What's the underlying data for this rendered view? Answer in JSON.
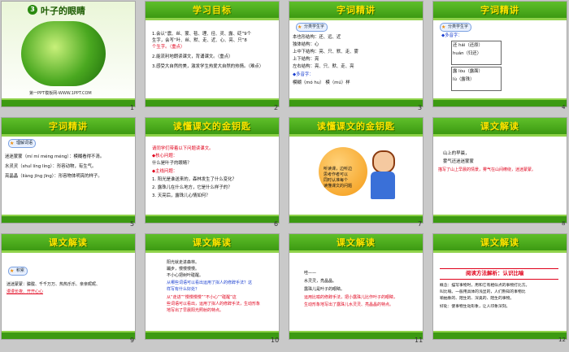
{
  "slides": [
    {
      "num": "1",
      "title": "叶子的眼睛",
      "badge_num": "3",
      "footer": "第一PPT模板网-WWW.1PPT.COM"
    },
    {
      "num": "2",
      "title": "学习目标",
      "lines": [
        "1.会认“震、丝、蒙、毯、理、径、灵、露、砭”9个",
        "  生字，会写“叶、丝、默、走、近、心、亮、只”8",
        "  个生字。（重点）",
        "2.能流利地朗读课文，背诵课文。（重点）",
        "3.感受大自然的美，激发学生热爱大自然的热情。（难点）"
      ]
    },
    {
      "num": "3",
      "title": "字词精讲",
      "badge": "分类学生字",
      "lines": [
        "  本也形结构：还、远、近",
        "  独体结构：心",
        "  上中下结构：亮、只、默、走、雾",
        "  上下结构：亮",
        "  左右结构：亮、只、默、走、亮",
        "  ◆多音字：",
        "  模糊（mó hu）    模（mú）样"
      ]
    },
    {
      "num": "4",
      "title": "字词精讲",
      "badge": "分类学生字",
      "lines": [
        "◆多音字：",
        "还  hái（还原）",
        "     huán（归还）",
        "露  lòu（露面）",
        "     lù（露珠）"
      ]
    },
    {
      "num": "5",
      "title": "字词精讲",
      "badge": "理解词语",
      "lines": [
        "迷迷蒙蒙（mí mí méng méng）：模糊看得不清。",
        "水灵灵（shuǐ líng líng）：形容动物，有生气。",
        "亮晶晶（liàng jīng jīng）：形容物体明亮的样子。"
      ]
    },
    {
      "num": "6",
      "title": "读懂课文的金钥匙",
      "lines": [
        "请同学们带着以下问题读课文。",
        "◆核心问题：",
        "  什么是叶子的眼睛？",
        "◆主线问题：",
        "  1. 阳光是谁送来的，森林发生了什么变化？",
        "  2. 露珠儿在什么地方，它是什么样子的？",
        "  3. 天亮后，露珠儿心情如何？"
      ]
    },
    {
      "num": "7",
      "title": "读懂课文的金钥匙",
      "bubble": [
        "听读课，边听边",
        "思考作者可以",
        "同时认准每个",
        "读懂课文的问题"
      ]
    },
    {
      "num": "8",
      "title": "课文解读",
      "lines": [
        "山上的早晨，",
        "雾气还迷迷蒙蒙",
        "描写了山上早晨的情景，雾气在山间缭绕，迷迷蒙蒙。"
      ]
    },
    {
      "num": "9",
      "title": "课文解读",
      "badge": "积累",
      "lines": [
        "迷迷蒙蒙：朦胧、千千万万、热热乐乐、亲亲昵昵、",
        "漫漫长夜、开开心心"
      ]
    },
    {
      "num": "10",
      "title": "课文解读",
      "lines": [
        "阳光就走进森林。",
        "  蹦步，慢慢慢慢。",
        "  不小心把树叶碰醒。",
        "从哪些词语可以看出运用了拟人的修辞手法？这",
        "样写有什么好处？",
        "从“走进”“慢慢慢慢”“不小心”“碰醒”这",
        "些词语可以看出，运用了拟人的修辞手法，生动形象",
        "地写出了早晨阳光照射的特点。"
      ]
    },
    {
      "num": "11",
      "title": "课文解读",
      "lines": [
        "哇——",
        "  水灵灵，亮晶晶。",
        "  露珠儿是叶子的眼睛。",
        "运用比喻的修辞手法，把小露珠儿比作叶子的眼睛，",
        "生动形象地写出了露珠儿水灵灵、亮晶晶的特点。"
      ]
    },
    {
      "num": "12",
      "title": "课文解读",
      "subtitle": "阅读方法解析：认识比喻",
      "lines": [
        "概念：描写事物时，用和它有相似点的事物打比方。",
        "叫比喻。一般用具体的浅显的，人们熟知的事物比",
        "喻抽象的、陌生的、深奥的、陌生的事物。",
        "好处：使事物生动形象，让人印象深刻。"
      ]
    }
  ]
}
